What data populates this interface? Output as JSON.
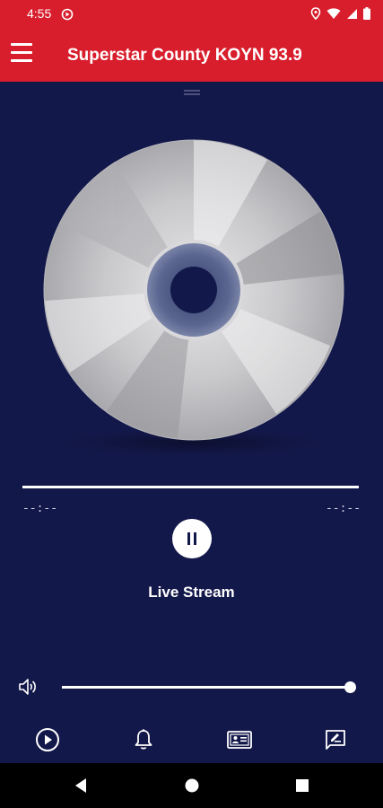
{
  "status_bar": {
    "time": "4:55",
    "icons": [
      "play-circle-icon",
      "location-icon",
      "wifi-icon",
      "signal-icon",
      "battery-icon"
    ]
  },
  "app_bar": {
    "title": "Superstar County KOYN 93.9",
    "menu_icon": "hamburger-menu-icon"
  },
  "player": {
    "elapsed": "--:--",
    "duration": "--:--",
    "progress": 1.0,
    "play_state_icon": "pause-icon",
    "track_title": "Live Stream",
    "volume_level": 1.0
  },
  "bottom_nav": {
    "items": [
      "play-circle-icon",
      "bell-icon",
      "contact-card-icon",
      "feedback-icon"
    ]
  },
  "system_nav": {
    "items": [
      "back-icon",
      "home-icon",
      "recents-icon"
    ]
  },
  "colors": {
    "app_bar": "#d81e2c",
    "background": "#13184a",
    "system_nav": "#000000"
  }
}
